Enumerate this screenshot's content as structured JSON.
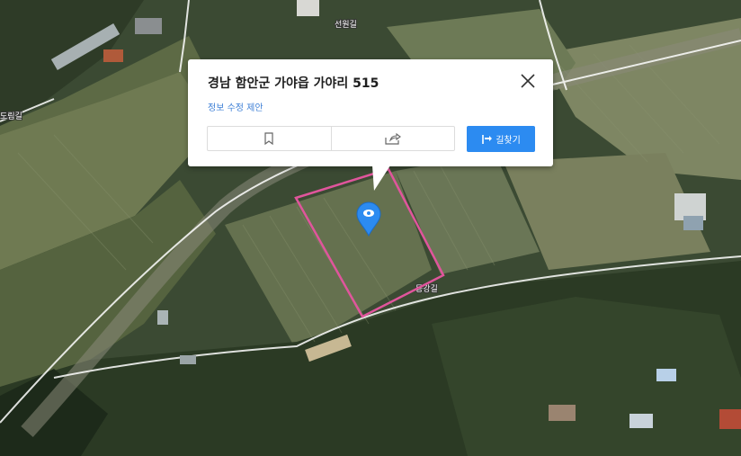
{
  "map": {
    "road_labels": [
      "선원길",
      "도림길",
      "동강길"
    ],
    "marker_color": "#2c8bf1",
    "parcel_outline_color": "#e0559c"
  },
  "popup": {
    "address": "경남 함안군 가야읍 가야리 515",
    "suggest_edit": "정보 수정 제안",
    "route_label": "길찾기",
    "close_icon": "close-icon",
    "save_icon": "bookmark-icon",
    "share_icon": "share-icon",
    "route_icon": "route-icon",
    "accent_color": "#2c8bf1"
  }
}
